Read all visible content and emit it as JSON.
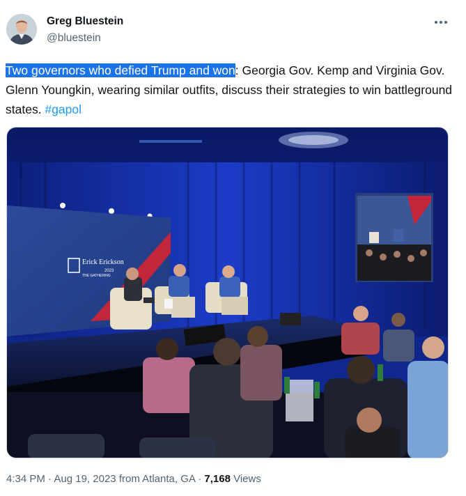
{
  "author": {
    "name": "Greg Bluestein",
    "handle": "@bluestein"
  },
  "tweet": {
    "highlighted_text": "Two governors who defied Trump and won",
    "body_text": ": Georgia Gov. Kemp and Virginia Gov. Glenn Youngkin, wearing similar outfits, discuss their strategies to win battleground states. ",
    "hashtag": "#gapol"
  },
  "media": {
    "stage_screen_logo": "Erick Erickson",
    "stage_screen_year": "2023",
    "stage_screen_subtitle": "THE GATHERING"
  },
  "meta": {
    "time": "4:34 PM",
    "separator": "·",
    "date": "Aug 19, 2023",
    "from_prefix": "from",
    "location": "Atlanta, GA",
    "views_count": "7,168",
    "views_label": "Views"
  },
  "colors": {
    "highlight": "#1a73e8",
    "hashtag": "#1d9bf0",
    "secondary_text": "#536471"
  }
}
